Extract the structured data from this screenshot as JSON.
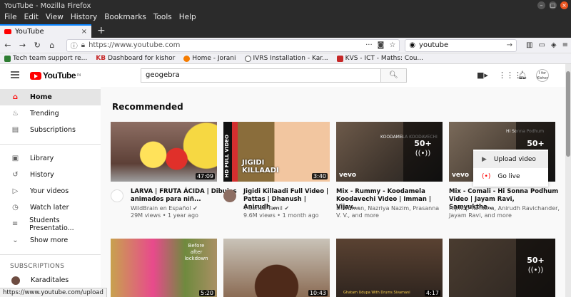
{
  "window": {
    "title": "YouTube - Mozilla Firefox"
  },
  "menu": [
    "File",
    "Edit",
    "View",
    "History",
    "Bookmarks",
    "Tools",
    "Help"
  ],
  "tab": {
    "label": "YouTube"
  },
  "url": "https://www.youtube.com",
  "search_box": {
    "value": "youtube"
  },
  "bookmarks": [
    {
      "label": "Tech team support re...",
      "color": "#2e7d32"
    },
    {
      "label": "Dashboard for kishor",
      "prefix": "KB"
    },
    {
      "label": "Home - Jorani",
      "color": "#f57c00"
    },
    {
      "label": "IVRS Installation - Kar...",
      "color": "#555555"
    },
    {
      "label": "KVS - ICT - Maths: Cou...",
      "color": "#c62828"
    }
  ],
  "yt": {
    "logo_text": "YouTube",
    "logo_region": "IN",
    "search_value": "geogebra",
    "avatar_text": "I for Kishor"
  },
  "sidebar": {
    "items": [
      {
        "label": "Home",
        "icon": "home-icon",
        "glyph": "⌂"
      },
      {
        "label": "Trending",
        "icon": "flame-icon",
        "glyph": "♨"
      },
      {
        "label": "Subscriptions",
        "icon": "subscriptions-icon",
        "glyph": "▤"
      }
    ],
    "items2": [
      {
        "label": "Library",
        "icon": "library-icon",
        "glyph": "▣"
      },
      {
        "label": "History",
        "icon": "history-icon",
        "glyph": "↺"
      },
      {
        "label": "Your videos",
        "icon": "your-videos-icon",
        "glyph": "▷"
      },
      {
        "label": "Watch later",
        "icon": "clock-icon",
        "glyph": "◷"
      },
      {
        "label": "Students Presentatio...",
        "icon": "playlist-icon",
        "glyph": "≡"
      },
      {
        "label": "Show more",
        "icon": "chevron-down-icon",
        "glyph": "⌄"
      }
    ],
    "subs_header": "SUBSCRIPTIONS",
    "subs": [
      {
        "label": "Karaditales"
      }
    ]
  },
  "main": {
    "heading": "Recommended"
  },
  "videos": [
    {
      "title": "LARVA | FRUTA ÁCIDA | Dibujos animados para niñ...",
      "channel": "WildBrain en Español ✔",
      "stats": "29M views • 1 year ago",
      "duration": "47:09"
    },
    {
      "title": "Jigidi Killaadi Full Video | Pattas | Dhanush | Anirudh ...",
      "channel": "T-Series Tamil ✔",
      "stats": "9.6M views • 1 month ago",
      "duration": "3:40",
      "thumb_text": "JIGIDI KILLAADI",
      "thumb_side": "HD FULL VIDEO"
    },
    {
      "title": "Mix - Rummy - Koodamela Koodavechi Video | Imman | Vijay...",
      "channel": "D. Imman, Nazriya Nazim, Prasanna V. V., and more",
      "mix_count": "50+",
      "thumb_caption": "KOODAMELA KOODAVECHI",
      "thumb_logo": "vevo"
    },
    {
      "title": "Mix - Comali - Hi Sonna Podhum Video | Jayam Ravi, Samyuktha...",
      "channel": "Hiphop Tamizha, Anirudh Ravichander, Jayam Ravi, and more",
      "mix_count": "50+",
      "thumb_caption": "Hi Sonna Podhum",
      "thumb_logo": "vevo"
    },
    {
      "duration": "5:20",
      "thumb_caption": "Before after lockdown"
    },
    {
      "duration": "10:43"
    },
    {
      "duration": "4:17",
      "thumb_caption": "Ghatam Udupa With Drums Sivamani"
    },
    {
      "mix_count": "50+"
    }
  ],
  "dropdown": [
    {
      "label": "Upload video",
      "icon": "upload-icon"
    },
    {
      "label": "Go live",
      "icon": "live-icon"
    }
  ],
  "status_url": "https://www.youtube.com/upload"
}
